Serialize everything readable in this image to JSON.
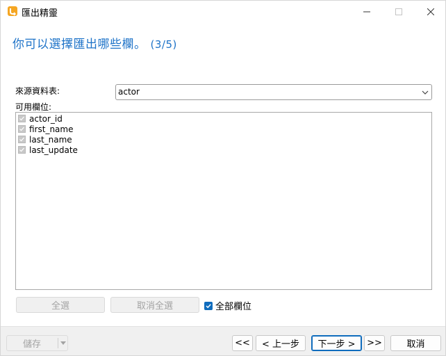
{
  "window": {
    "title": "匯出精靈",
    "app_icon": "wizard-app-icon",
    "controls": [
      "minimize-icon",
      "maximize-icon",
      "close-icon"
    ]
  },
  "header": {
    "title": "你可以選擇匯出哪些欄。",
    "step": "(3/5)"
  },
  "source": {
    "label": "來源資料表:",
    "selected": "actor"
  },
  "fields": {
    "label": "可用欄位:",
    "items": [
      {
        "name": "actor_id",
        "checked": true
      },
      {
        "name": "first_name",
        "checked": true
      },
      {
        "name": "last_name",
        "checked": true
      },
      {
        "name": "last_update",
        "checked": true
      }
    ]
  },
  "actions": {
    "select_all": "全選",
    "deselect_all": "取消全選",
    "all_fields": "全部欄位",
    "all_fields_checked": true
  },
  "footer": {
    "save": "儲存",
    "first": "<<",
    "prev": "< 上一步",
    "next": "下一步 >",
    "last": ">>",
    "cancel": "取消"
  },
  "colors": {
    "accent": "#0f6cbd",
    "title": "#1e73c8",
    "disabled_text": "#a3a3a3"
  }
}
